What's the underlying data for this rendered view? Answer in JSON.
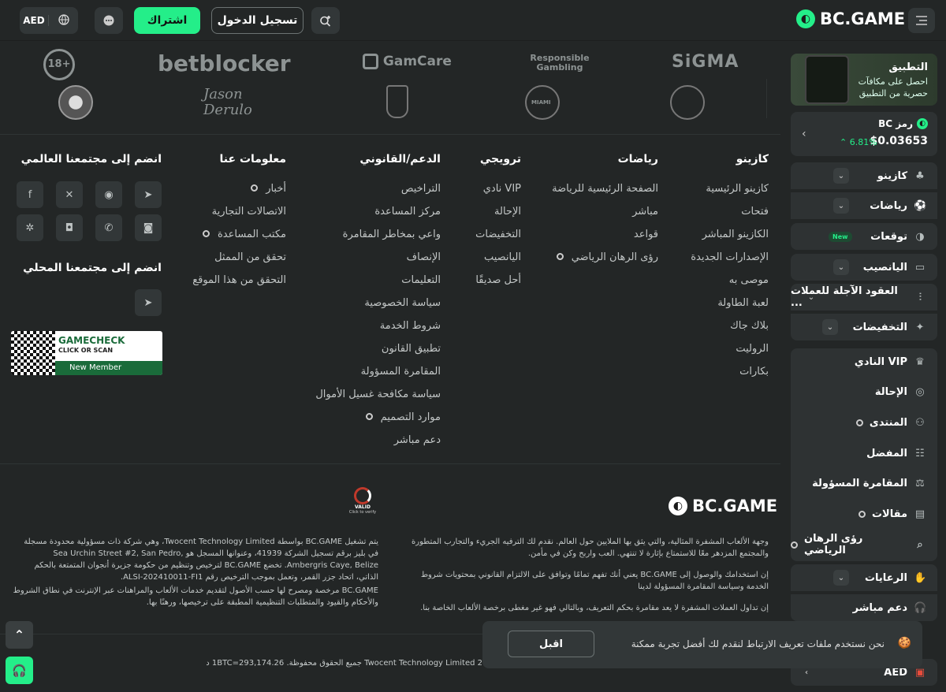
{
  "header": {
    "brand": "BC.GAME",
    "login_label": "تسجيل الدخول",
    "signup_label": "اشتراك",
    "currency": "AED"
  },
  "sidebar": {
    "app_title": "التطبيق",
    "app_subtitle": "احصل على مكافآت حصرية من التطبيق",
    "token_name": "رمز BC",
    "token_price": "$0.03653",
    "token_change": "6.81%",
    "items": [
      {
        "label": "كازينو",
        "icon": "casino-icon"
      },
      {
        "label": "رياضات",
        "icon": "sports-icon"
      },
      {
        "label": "توقعات",
        "icon": "predictions-icon",
        "badge": "New"
      },
      {
        "label": "اليانصيب",
        "icon": "lottery-icon"
      },
      {
        "label": "العقود الآجلة للعملات ...",
        "icon": "futures-icon"
      },
      {
        "label": "التخفيضات",
        "icon": "promotions-icon"
      },
      {
        "label": "النادي VIP",
        "icon": "vip-icon"
      },
      {
        "label": "الإحالة",
        "icon": "referral-icon"
      },
      {
        "label": "المنتدى",
        "icon": "forum-icon"
      },
      {
        "label": "المفضل",
        "icon": "favorites-icon"
      },
      {
        "label": "المقامرة المسؤولة",
        "icon": "responsible-icon"
      },
      {
        "label": "مقالات",
        "icon": "articles-icon"
      },
      {
        "label": "رؤى الرهان الرياضي",
        "icon": "insights-icon"
      },
      {
        "label": "الرعايات",
        "icon": "sponsorships-icon"
      },
      {
        "label": "دعم مباشر",
        "icon": "live-support-icon"
      },
      {
        "label": "AED",
        "icon": "language-icon"
      }
    ]
  },
  "partners": {
    "row1": [
      "SiGMA",
      "Responsible Gambling",
      "GamCare",
      "betblocker",
      "18+"
    ],
    "signature": "Jason Derulo",
    "club_miami": "MIAMI"
  },
  "footer": {
    "casino": {
      "title": "كازينو",
      "links": [
        "كازينو الرئيسية",
        "فتحات",
        "الكازينو المباشر",
        "الإصدارات الجديدة",
        "موصى به",
        "لعبة الطاولة",
        "بلاك جاك",
        "الروليت",
        "بكارات"
      ]
    },
    "sports": {
      "title": "رياضات",
      "links": [
        "الصفحة الرئيسية للرياضة",
        "مباشر",
        "قواعد",
        "رؤى الرهان الرياضي"
      ]
    },
    "promo": {
      "title": "ترويجي",
      "links": [
        "نادي VIP",
        "الإحالة",
        "التخفيضات",
        "اليانصيب",
        "أحل صديقًا"
      ]
    },
    "support": {
      "title": "الدعم/القانوني",
      "links": [
        "التراخيص",
        "مركز المساعدة",
        "واعي بمخاطر المقامرة",
        "الإنصاف",
        "التعليمات",
        "سياسة الخصوصية",
        "شروط الخدمة",
        "تطبيق القانون",
        "المقامرة المسؤولة",
        "سياسة مكافحة غسيل الأموال",
        "موارد التصميم",
        "دعم مباشر"
      ]
    },
    "about": {
      "title": "معلومات عنا",
      "links": [
        "أخبار",
        "الاتصالات التجارية",
        "مكتب المساعدة",
        "تحقق من الممثل",
        "التحقق من هذا الموقع"
      ]
    },
    "community_title": "انضم إلى مجتمعنا العالمي",
    "local_title": "انضم إلى مجتمعنا المحلي",
    "gamecheck_title": "GAMECHECK",
    "gamecheck_sub": "CLICK OR SCAN",
    "gamecheck_member": "New Member",
    "valid_text": "VALID",
    "valid_sub": "Click to verify",
    "brand": "BC.GAME",
    "para_right_1": "وجهة الألعاب المشفرة المثالية، والتي يثق بها الملايين حول العالم. نقدم لك الترفيه الجريء والتجارب المتطورة والمجتمع المزدهر معًا للاستمتاع بإثارة لا تنتهي. العب واربح وكن في مأمن.",
    "para_right_2": "إن استخدامك والوصول إلى BC.GAME يعني أنك تفهم تمامًا وتوافق على الالتزام القانوني بمحتويات شروط الخدمة وسياسة المقامرة المسؤولة لدينا",
    "para_right_3": "إن تداول العملات المشفرة لا يعد مقامرة بحكم التعريف، وبالتالي فهو غير مغطى برخصة الألعاب الخاصة بنا.",
    "para_left_1": "يتم تشغيل BC.GAME بواسطة Twocent Technology Limited، وهي شركة ذات مسؤولية محدودة مسجلة في بليز برقم تسجيل الشركة 41939، وعنوانها المسجل هو Sea Urchin Street #2, San Pedro, Ambergris Caye, Belize. تخضع BC.GAME لترخيص وتنظيم من حكومة جزيرة أنجوان المتمتعة بالحكم الذاتي، اتحاد جزر القمر، وتعمل بموجب الترخيص رقم ALSI-202410011-FI1.",
    "para_left_2": "BC.GAME مرخصة ومصرح لها حسب الأصول لتقديم خدمات الألعاب والمراهنات عبر الإنترنت في نطاق الشروط والأحكام والقيود والمتطلبات التنظيمية المطبقة على ترخيصها، ورهنًا بها.",
    "copyright": "Twocent Technology Limited 2 جميع الحقوق محفوظة. 1BTC=293,174.26 د.إ."
  },
  "cookie": {
    "message": "نحن نستخدم ملفات تعريف الارتباط لنقدم لك أفضل تجربة ممكنة",
    "accept": "اقبل"
  },
  "colors": {
    "accent": "#24ee89",
    "background": "#232626",
    "panel": "#323738"
  }
}
